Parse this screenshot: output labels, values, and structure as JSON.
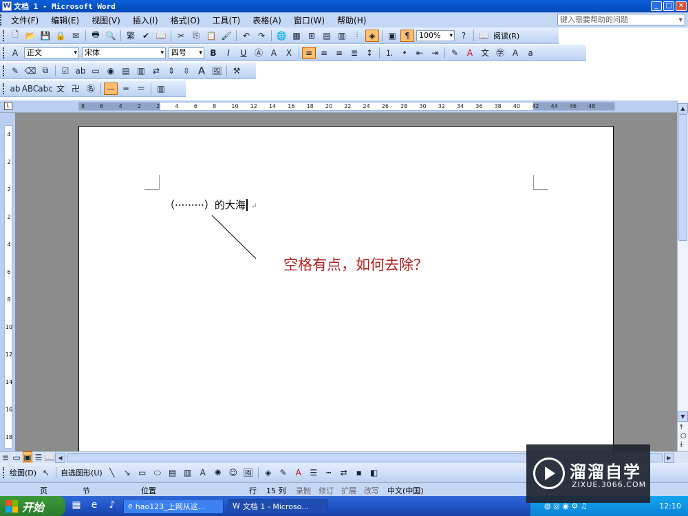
{
  "window": {
    "title": "文档 1 - Microsoft Word",
    "app_icon": "W"
  },
  "menu": {
    "items": [
      "文件(F)",
      "编辑(E)",
      "视图(V)",
      "插入(I)",
      "格式(O)",
      "工具(T)",
      "表格(A)",
      "窗口(W)",
      "帮助(H)"
    ],
    "help_placeholder": "键入需要帮助的问题"
  },
  "standard_toolbar": {
    "zoom": "100%",
    "read_label": "阅读(R)"
  },
  "format_toolbar": {
    "style": "正文",
    "font": "宋体",
    "size": "四号"
  },
  "ruler": {
    "h_ticks": [
      "8",
      "6",
      "4",
      "2",
      "2",
      "4",
      "6",
      "8",
      "10",
      "12",
      "14",
      "16",
      "18",
      "20",
      "22",
      "24",
      "26",
      "28",
      "30",
      "32",
      "34",
      "36",
      "38",
      "40",
      "42",
      "44",
      "46",
      "48"
    ],
    "v_ticks": [
      "4",
      "2",
      "2",
      "2",
      "4",
      "6",
      "8",
      "10",
      "12",
      "14",
      "16",
      "18"
    ]
  },
  "document": {
    "line_text": "（·········）的大海",
    "annotation": "空格有点，如何去除？"
  },
  "draw_toolbar": {
    "draw_label": "绘图(D)",
    "autoshape_label": "自选图形(U)"
  },
  "statusbar": {
    "page": "页",
    "section": "节",
    "position": "位置",
    "line": "行",
    "col": "15 列",
    "rec": "录制",
    "trk": "修订",
    "ext": "扩展",
    "ovr": "改写",
    "lang": "中文(中国)"
  },
  "taskbar": {
    "start": "开始",
    "tasks": [
      "hao123_上网从这...",
      "文档 1 - Microso..."
    ],
    "clock": "12:10"
  },
  "watermark": {
    "name": "溜溜自学",
    "site": "ZIXUE.3066.COM"
  },
  "colors": {
    "accent": "#0a5fd8",
    "annotation": "#b02020",
    "menubar": "#c4d7f5"
  }
}
